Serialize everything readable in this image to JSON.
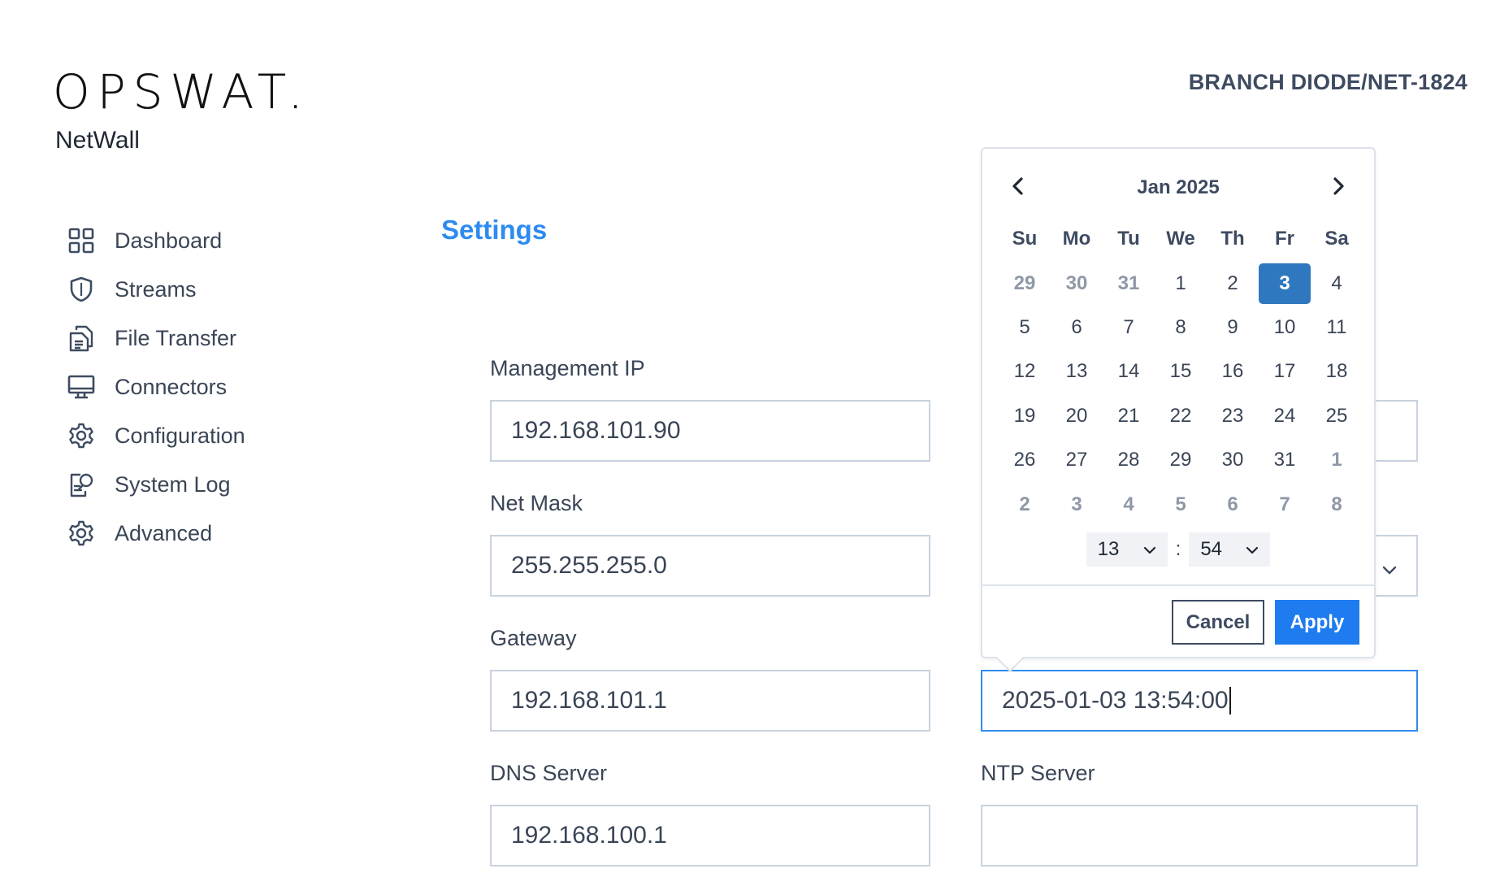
{
  "brand": {
    "logo_text": "OPSWAT.",
    "product": "NetWall"
  },
  "device_name": "BRANCH DIODE/NET-1824",
  "sidebar": {
    "items": [
      {
        "label": "Dashboard",
        "icon": "dashboard-grid-icon"
      },
      {
        "label": "Streams",
        "icon": "shield-icon"
      },
      {
        "label": "File Transfer",
        "icon": "files-icon"
      },
      {
        "label": "Connectors",
        "icon": "monitor-icon"
      },
      {
        "label": "Configuration",
        "icon": "gear-icon"
      },
      {
        "label": "System Log",
        "icon": "log-search-icon"
      },
      {
        "label": "Advanced",
        "icon": "gear-icon"
      }
    ]
  },
  "page_title": "Settings",
  "form": {
    "management_ip": {
      "label": "Management IP",
      "value": "192.168.101.90"
    },
    "net_mask": {
      "label": "Net Mask",
      "value": "255.255.255.0"
    },
    "gateway": {
      "label": "Gateway",
      "value": "192.168.101.1"
    },
    "dns_server": {
      "label": "DNS Server",
      "value": "192.168.100.1"
    },
    "date_time": {
      "value": "2025-01-03 13:54:00"
    },
    "ntp_server": {
      "label": "NTP Server",
      "value": ""
    }
  },
  "date_picker": {
    "month_label": "Jan 2025",
    "weekdays": [
      "Su",
      "Mo",
      "Tu",
      "We",
      "Th",
      "Fr",
      "Sa"
    ],
    "weeks": [
      [
        {
          "d": "29",
          "m": true
        },
        {
          "d": "30",
          "m": true
        },
        {
          "d": "31",
          "m": true
        },
        {
          "d": "1"
        },
        {
          "d": "2"
        },
        {
          "d": "3",
          "s": true
        },
        {
          "d": "4"
        }
      ],
      [
        {
          "d": "5"
        },
        {
          "d": "6"
        },
        {
          "d": "7"
        },
        {
          "d": "8"
        },
        {
          "d": "9"
        },
        {
          "d": "10"
        },
        {
          "d": "11"
        }
      ],
      [
        {
          "d": "12"
        },
        {
          "d": "13"
        },
        {
          "d": "14"
        },
        {
          "d": "15"
        },
        {
          "d": "16"
        },
        {
          "d": "17"
        },
        {
          "d": "18"
        }
      ],
      [
        {
          "d": "19"
        },
        {
          "d": "20"
        },
        {
          "d": "21"
        },
        {
          "d": "22"
        },
        {
          "d": "23"
        },
        {
          "d": "24"
        },
        {
          "d": "25"
        }
      ],
      [
        {
          "d": "26"
        },
        {
          "d": "27"
        },
        {
          "d": "28"
        },
        {
          "d": "29"
        },
        {
          "d": "30"
        },
        {
          "d": "31"
        },
        {
          "d": "1",
          "m": true
        }
      ],
      [
        {
          "d": "2",
          "m": true
        },
        {
          "d": "3",
          "m": true
        },
        {
          "d": "4",
          "m": true
        },
        {
          "d": "5",
          "m": true
        },
        {
          "d": "6",
          "m": true
        },
        {
          "d": "7",
          "m": true
        },
        {
          "d": "8",
          "m": true
        }
      ]
    ],
    "selected_day": "3",
    "hour": "13",
    "minute": "54",
    "time_separator": ":",
    "cancel_label": "Cancel",
    "apply_label": "Apply"
  },
  "colors": {
    "accent": "#2e8bf0",
    "apply_button": "#1f7cf0",
    "selected_day": "#2f78bf",
    "text": "#3a4556",
    "border": "#c9d2de"
  }
}
